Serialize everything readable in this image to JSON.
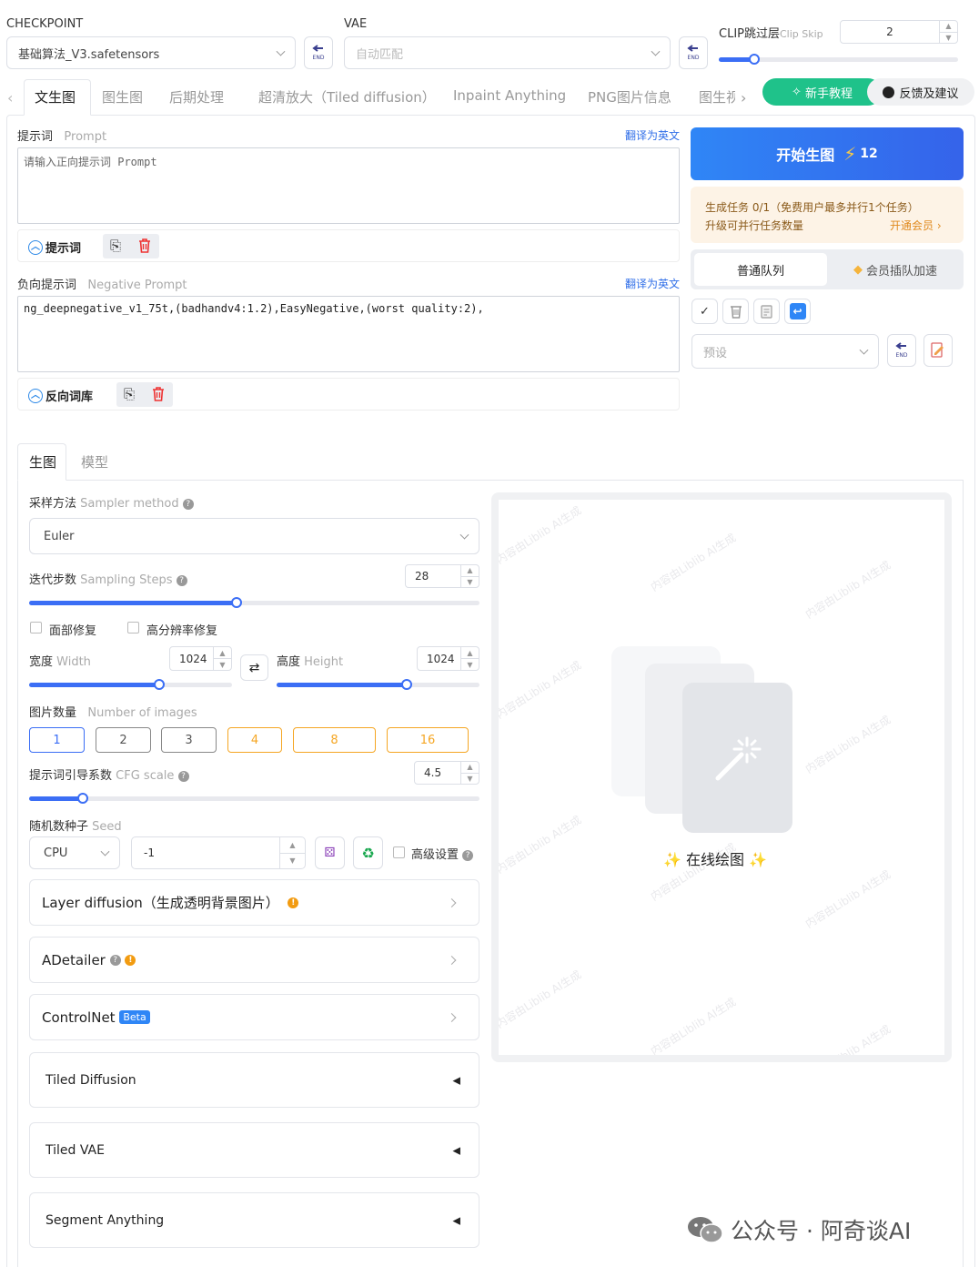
{
  "header": {
    "checkpoint_label": "CHECKPOINT",
    "checkpoint_value": "基础算法_V3.safetensors",
    "vae_label": "VAE",
    "vae_value": "自动匹配",
    "clip_label": "CLIP跳过层",
    "clip_sub": "Clip Skip",
    "clip_value": "2",
    "clip_slider_fraction": 0.15,
    "end_icon_text": "END"
  },
  "tabs": [
    "文生图",
    "图生图",
    "后期处理",
    "超清放大（Tiled diffusion）",
    "Inpaint Anything",
    "PNG图片信息",
    "图生视"
  ],
  "active_tab": "文生图",
  "tutorial_button": "新手教程",
  "feedback_button": "反馈及建议",
  "prompt": {
    "label": "提示词",
    "sub": "Prompt",
    "translate": "翻译为英文",
    "placeholder": "请输入正向提示词 Prompt",
    "toggle_label": "提示词"
  },
  "negative_prompt": {
    "label": "负向提示词",
    "sub": "Negative Prompt",
    "translate": "翻译为英文",
    "value": "ng_deepnegative_v1_75t,(badhandv4:1.2),EasyNegative,(worst quality:2),",
    "toggle_label": "反向词库"
  },
  "generate": {
    "label": "开始生图",
    "cost": "12",
    "task_info": "生成任务 0/1（免费用户最多并行1个任务）",
    "upgrade_text": "升级可并行任务数量",
    "vip_link": "开通会员 ›",
    "queue_normal": "普通队列",
    "queue_vip": "会员插队加速",
    "preset_placeholder": "预设"
  },
  "sub_tabs": [
    "生图",
    "模型"
  ],
  "sampler": {
    "label": "采样方法",
    "sub": "Sampler method",
    "value": "Euler"
  },
  "steps": {
    "label": "迭代步数",
    "sub": "Sampling Steps",
    "value": "28",
    "fraction": 0.46
  },
  "face_fix": "面部修复",
  "hires_fix": "高分辨率修复",
  "width": {
    "label": "宽度",
    "sub": "Width",
    "value": "1024",
    "fraction": 0.64
  },
  "height": {
    "label": "高度",
    "sub": "Height",
    "value": "1024",
    "fraction": 0.64
  },
  "swap_icon": "⇄",
  "batch": {
    "label": "图片数量",
    "sub": "Number of images",
    "options": [
      "1",
      "2",
      "3",
      "4",
      "8",
      "16"
    ],
    "selected": "1"
  },
  "cfg": {
    "label": "提示词引导系数",
    "sub": "CFG scale",
    "value": "4.5",
    "fraction": 0.12
  },
  "seed": {
    "label": "随机数种子",
    "sub": "Seed",
    "device": "CPU",
    "value": "-1",
    "advanced": "高级设置"
  },
  "panels": {
    "layer_diffusion": "Layer diffusion（生成透明背景图片）",
    "adetailer": "ADetailer",
    "controlnet": "ControlNet",
    "controlnet_badge": "Beta",
    "tiled_diffusion": "Tiled Diffusion",
    "tiled_vae": "Tiled VAE",
    "segment_anything": "Segment Anything"
  },
  "preview": {
    "label": "在线绘图",
    "watermark": "内容由Liblib AI生成"
  },
  "footer_watermark": "公众号 · 阿奇谈AI",
  "colors": {
    "primary": "#3b6ef5",
    "accent_green": "#1fc28a",
    "orange": "#f5a623",
    "link": "#2f6ee8"
  }
}
